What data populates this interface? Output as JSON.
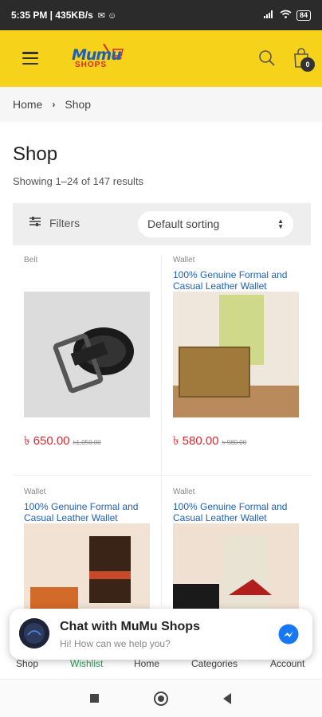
{
  "status_bar": {
    "time_and_speed": "5:35 PM | 435KB/s",
    "battery": "84"
  },
  "header": {
    "logo_top": "Mumu",
    "logo_bottom": "SHOPS",
    "cart_count": "0"
  },
  "breadcrumb": {
    "home": "Home",
    "separator": "›",
    "current": "Shop"
  },
  "page": {
    "title": "Shop",
    "result_count": "Showing 1–24 of 147 results"
  },
  "toolbar": {
    "filters_label": "Filters",
    "sorting_value": "Default sorting"
  },
  "products": [
    {
      "category": "Belt",
      "title": "",
      "price": "৳ 650.00",
      "old_price": "৳1,050.00"
    },
    {
      "category": "Wallet",
      "title": "100% Genuine Formal and Casual Leather Wallet",
      "price": "৳ 580.00",
      "old_price": "৳ 980.00"
    },
    {
      "category": "Wallet",
      "title": "100% Genuine Formal and Casual Leather Wallet"
    },
    {
      "category": "Wallet",
      "title": "100% Genuine Formal and Casual Leather Wallet"
    }
  ],
  "chat": {
    "title": "Chat with MuMu Shops",
    "subtitle": "Hi! How can we help you?"
  },
  "bottom_nav": {
    "shop": "Shop",
    "wishlist": "Wishlist",
    "home": "Home",
    "categories": "Categories",
    "account": "Account"
  },
  "colors": {
    "brand_yellow": "#f7d21a",
    "link_blue": "#1f5fb8",
    "price_red": "#e0262b"
  },
  "icons": [
    "menu-icon",
    "search-icon",
    "cart-icon",
    "filter-icon",
    "sort-arrows-icon",
    "messenger-icon",
    "square-nav-icon",
    "circle-nav-icon",
    "back-nav-icon"
  ]
}
